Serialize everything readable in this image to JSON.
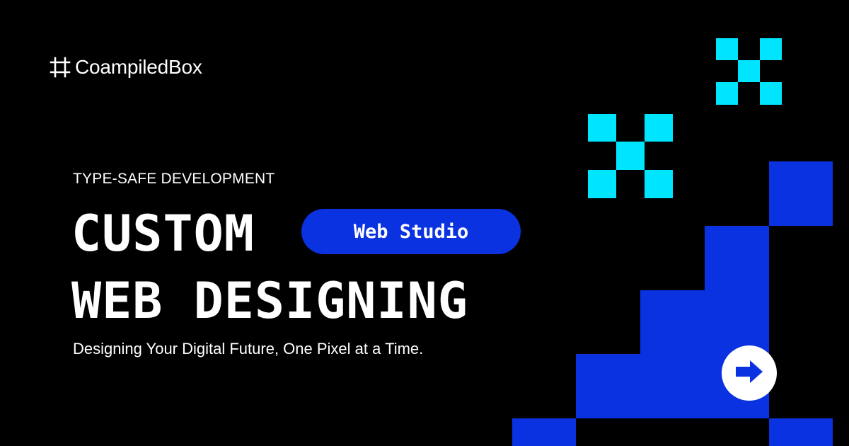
{
  "brand": {
    "name": "CoampiledBox",
    "logo_icon": "hash-frame-icon"
  },
  "hero": {
    "eyebrow": "TYPE-SAFE DEVELOPMENT",
    "headline_line1": "CUSTOM",
    "headline_line2": "WEB DESIGNING",
    "badge": "Web Studio",
    "tagline": "Designing Your Digital Future, One Pixel at a Time."
  },
  "cta": {
    "icon": "arrow-right-icon"
  },
  "colors": {
    "background": "#000000",
    "accent_blue": "#0a32e0",
    "accent_cyan": "#00e5ff",
    "text": "#ffffff"
  }
}
